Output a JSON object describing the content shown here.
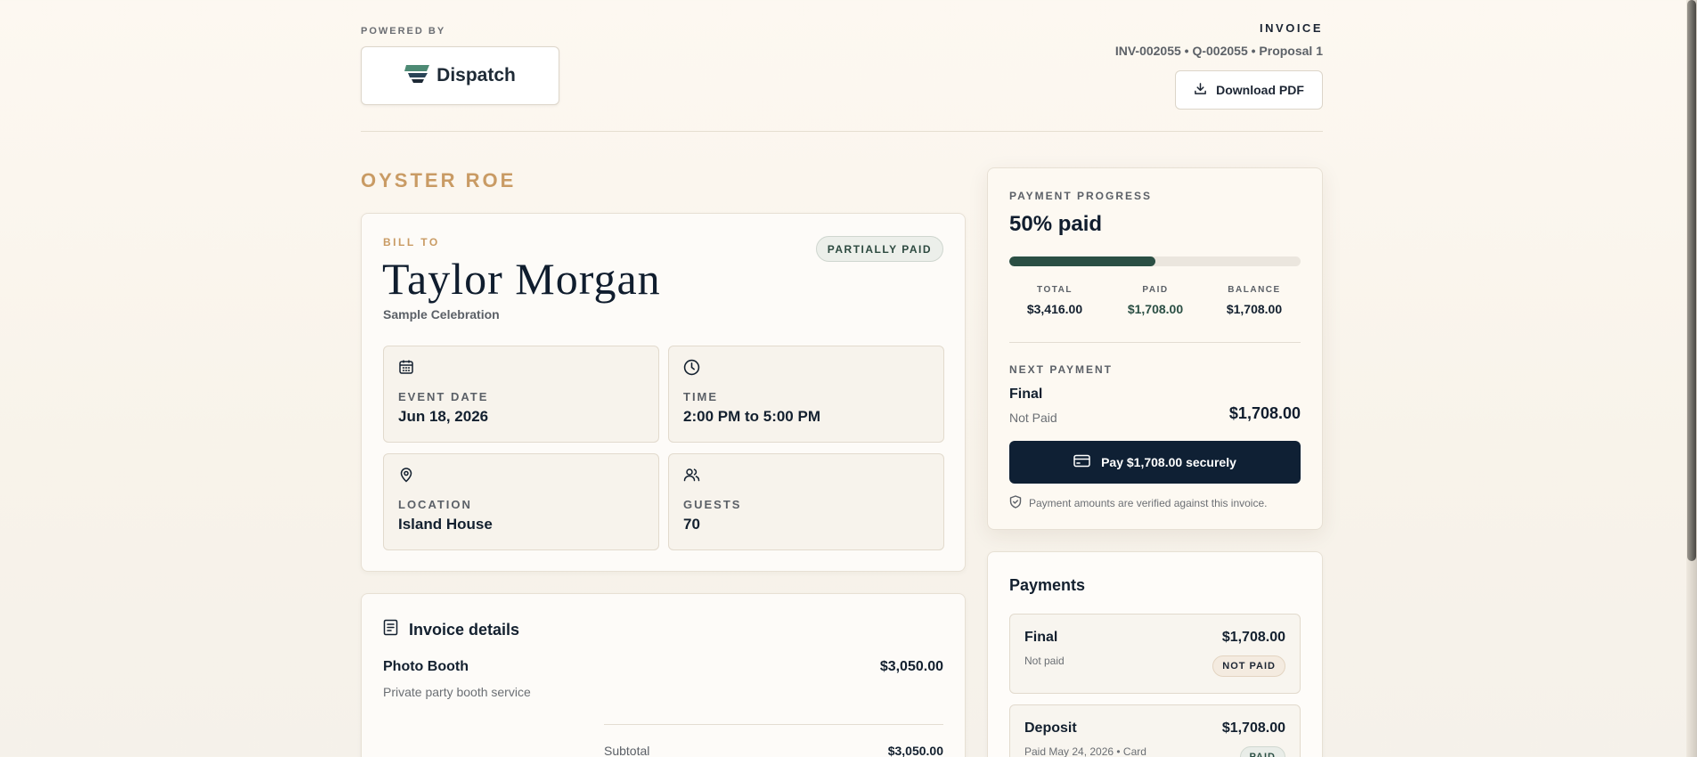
{
  "header": {
    "powered_by": "POWERED BY",
    "logo_name": "Dispatch",
    "invoice_label": "INVOICE",
    "invoice_ids": "INV-002055 • Q-002055 • Proposal 1",
    "download_label": "Download PDF"
  },
  "brand": "OYSTER ROE",
  "bill": {
    "bill_to_label": "BILL TO",
    "client_name": "Taylor Morgan",
    "event_name": "Sample Celebration",
    "status_badge": "PARTIALLY PAID",
    "tiles": [
      {
        "label": "EVENT DATE",
        "value": "Jun 18, 2026",
        "icon": "calendar-icon"
      },
      {
        "label": "TIME",
        "value": "2:00 PM to 5:00 PM",
        "icon": "clock-icon"
      },
      {
        "label": "LOCATION",
        "value": "Island House",
        "icon": "map-pin-icon"
      },
      {
        "label": "GUESTS",
        "value": "70",
        "icon": "users-icon"
      }
    ]
  },
  "details": {
    "title": "Invoice details",
    "line_items": [
      {
        "name": "Photo Booth",
        "description": "Private party booth service",
        "amount": "$3,050.00"
      }
    ],
    "subtotal_label": "Subtotal",
    "subtotal_amount": "$3,050.00"
  },
  "progress": {
    "label": "PAYMENT PROGRESS",
    "percent_text": "50% paid",
    "fraction": 0.5,
    "total_label": "TOTAL",
    "total_value": "$3,416.00",
    "paid_label": "PAID",
    "paid_value": "$1,708.00",
    "balance_label": "BALANCE",
    "balance_value": "$1,708.00",
    "next_payment_label": "NEXT PAYMENT",
    "next_name": "Final",
    "next_status": "Not Paid",
    "next_amount": "$1,708.00",
    "pay_button_label": "Pay $1,708.00 securely",
    "verify_text": "Payment amounts are verified against this invoice."
  },
  "payments": {
    "title": "Payments",
    "items": [
      {
        "name": "Final",
        "sub": "Not paid",
        "amount": "$1,708.00",
        "badge": "NOT PAID"
      },
      {
        "name": "Deposit",
        "sub": "Paid May 24, 2026 • Card",
        "amount": "$1,708.00",
        "badge": "PAID"
      }
    ]
  },
  "colors": {
    "accent_gold": "#c99b64",
    "primary_navy": "#0f2034",
    "progress_green": "#2b4f44"
  }
}
